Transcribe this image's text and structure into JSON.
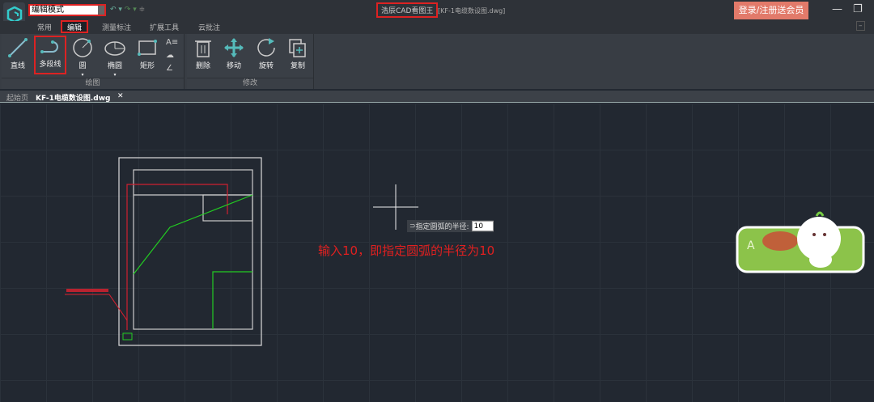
{
  "titlebar": {
    "mode": "编辑模式",
    "app_title": "浩辰CAD看图王",
    "file_title": "[KF-1电缆数设图.dwg]",
    "login": "登录/注册送会员",
    "minimize": "—",
    "restore": "❐"
  },
  "menu_tabs": [
    "常用",
    "编辑",
    "测量标注",
    "扩展工具",
    "云批注"
  ],
  "ribbon": {
    "draw_group": "绘图",
    "modify_group": "修改",
    "draw_tools": [
      "直线",
      "多段线",
      "圆",
      "椭圆",
      "矩形"
    ],
    "modify_tools": [
      "删除",
      "移动",
      "旋转",
      "复制"
    ]
  },
  "doc_tabs": {
    "home": "起始页",
    "file": "KF-1电缆数设图.dwg",
    "close": "✕"
  },
  "command": {
    "prompt": "指定圆弧的半径:",
    "value": "10"
  },
  "annotation": "输入10，即指定圆弧的半径为10",
  "colors": {
    "accent": "#e02020",
    "login": "#e27a6a",
    "canvas": "#222831"
  }
}
